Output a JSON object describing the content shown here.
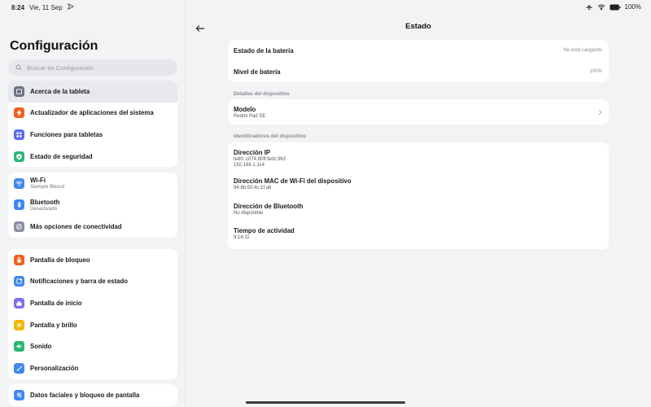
{
  "status_bar": {
    "time": "8:24",
    "date": "Vie, 11 Sep",
    "battery": "100%",
    "icons": [
      "airplane-icon",
      "wifi-icon",
      "battery-icon"
    ]
  },
  "left": {
    "title": "Configuración",
    "search_placeholder": "Buscar en Configuración",
    "group1": [
      {
        "label": "Acerca de la tableta",
        "icon": "tablet-icon",
        "color": "#6b7280"
      },
      {
        "label": "Actualizador de aplicaciones del sistema",
        "icon": "update-arrow-icon",
        "color": "#f0621e"
      },
      {
        "label": "Funciones para tabletas",
        "icon": "grid-icon",
        "color": "#5b6ef0"
      },
      {
        "label": "Estado de seguridad",
        "icon": "shield-check-icon",
        "color": "#2bb673"
      }
    ],
    "group2": [
      {
        "label": "Wi-Fi",
        "sub": "Siempre Blessd",
        "icon": "wifi-icon",
        "color": "#3f88f0"
      },
      {
        "label": "Bluetooth",
        "sub": "Desactivado",
        "icon": "bluetooth-icon",
        "color": "#3f88f0"
      },
      {
        "label": "Más opciones de conectividad",
        "icon": "link-icon",
        "color": "#8a8fa0"
      }
    ],
    "group3": [
      {
        "label": "Pantalla de bloqueo",
        "icon": "lock-icon",
        "color": "#f0621e"
      },
      {
        "label": "Notificaciones y barra de estado",
        "icon": "notification-icon",
        "color": "#3f88f0"
      },
      {
        "label": "Pantalla de inicio",
        "icon": "home-icon",
        "color": "#7b6ff0"
      },
      {
        "label": "Pantalla y brillo",
        "icon": "sun-icon",
        "color": "#f5b400"
      },
      {
        "label": "Sonido",
        "icon": "volume-icon",
        "color": "#2bb673"
      },
      {
        "label": "Personalización",
        "icon": "brush-icon",
        "color": "#3f88f0"
      }
    ],
    "group4": [
      {
        "label": "Datos faciales y bloqueo de pantalla",
        "icon": "fingerprint-icon",
        "color": "#3f88f0"
      }
    ]
  },
  "right": {
    "title": "Estado",
    "battery_state_label": "Estado de la batería",
    "battery_state_value": "No está cargando",
    "battery_level_label": "Nivel de batería",
    "battery_level_value": "100%",
    "section_device": "Detalles del dispositivo",
    "model_label": "Modelo",
    "model_value": "Redmi Pad SE",
    "section_ids": "Identificadores del dispositivo",
    "ip_label": "Dirección IP",
    "ip_value_1": "fe80::c074:80ff:fedc:9fcf",
    "ip_value_2": "192.168.1.114",
    "mac_label": "Dirección MAC de Wi-Fi del dispositivo",
    "mac_value": "94:8b:93:4c:1f:a6",
    "bt_label": "Dirección de Bluetooth",
    "bt_value": "No disponible",
    "uptime_label": "Tiempo de actividad",
    "uptime_value": "9:14:11"
  }
}
